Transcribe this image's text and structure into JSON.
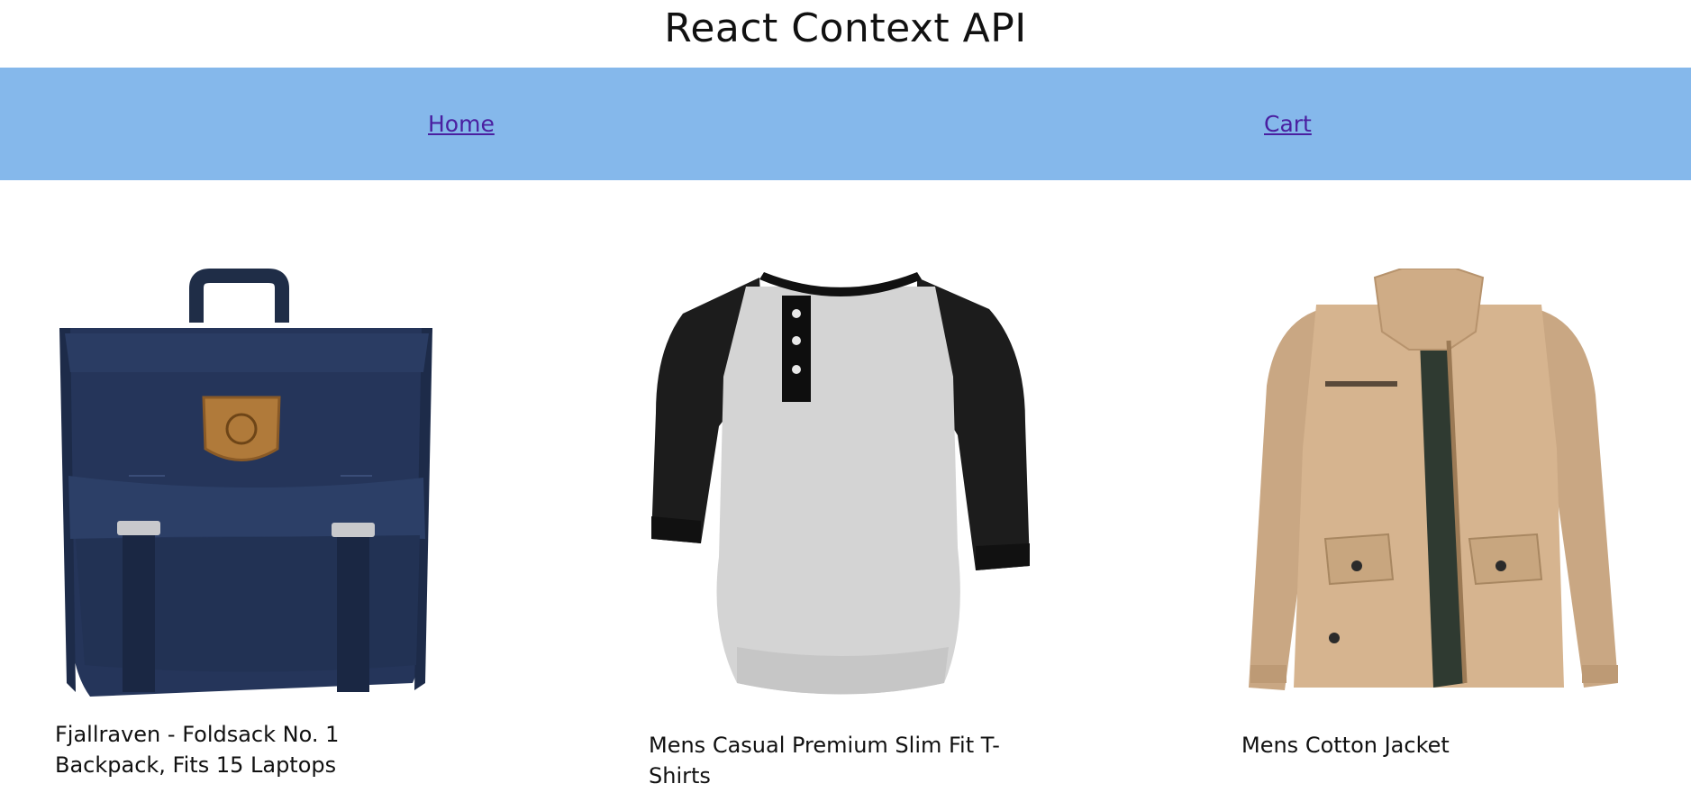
{
  "header": {
    "title": "React Context API"
  },
  "nav": {
    "home_label": "Home",
    "cart_label": "Cart",
    "background_color": "#85b8eb",
    "link_color": "#4a1fa0"
  },
  "products": [
    {
      "title": "Fjallraven - Foldsack No. 1 Backpack, Fits 15 Laptops",
      "image": "navy-backpack-image"
    },
    {
      "title": "Mens Casual Premium Slim Fit T-Shirts",
      "image": "raglan-henley-tshirt-image"
    },
    {
      "title": "Mens Cotton Jacket",
      "image": "khaki-cotton-jacket-image"
    }
  ]
}
